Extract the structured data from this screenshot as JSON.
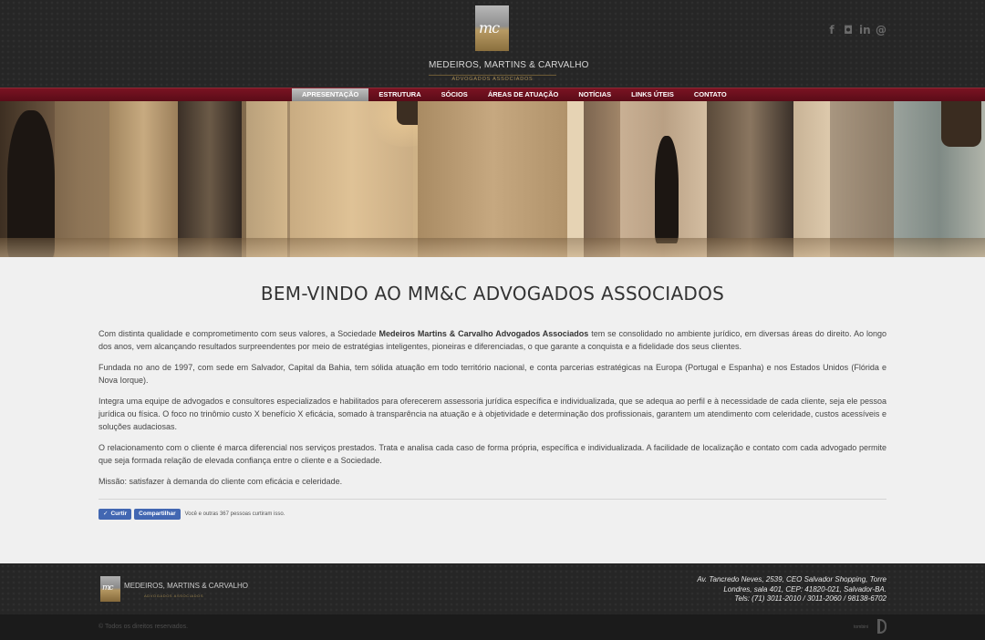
{
  "header": {
    "logo_initials": "mc",
    "logo_name": "MEDEIROS, MARTINS & CARVALHO",
    "logo_subtitle": "ADVOGADOS ASSOCIADOS",
    "social": [
      {
        "icon": "facebook-icon",
        "glyph": "f"
      },
      {
        "icon": "instagram-icon",
        "glyph": "◘"
      },
      {
        "icon": "linkedin-icon",
        "glyph": "in"
      },
      {
        "icon": "email-icon",
        "glyph": "@"
      }
    ]
  },
  "nav": {
    "items": [
      "APRESENTAÇÃO",
      "ESTRUTURA",
      "SÓCIOS",
      "ÁREAS DE ATUAÇÃO",
      "NOTÍCIAS",
      "LINKS ÚTEIS",
      "CONTATO"
    ],
    "active_index": 0
  },
  "main": {
    "title": "BEM-VINDO AO MM&C ADVOGADOS ASSOCIADOS",
    "p1_before": "Com distinta qualidade e comprometimento com seus valores, a Sociedade ",
    "p1_bold": "Medeiros Martins & Carvalho Advogados Associados",
    "p1_after": " tem se consolidado no ambiente jurídico, em diversas áreas do direito. Ao longo dos anos, vem alcançando resultados surpreendentes por meio de estratégias inteligentes, pioneiras e diferenciadas, o que garante a conquista e a fidelidade dos seus clientes.",
    "p2": "Fundada no ano de 1997, com sede em Salvador, Capital da Bahia, tem sólida atuação em todo território nacional, e conta parcerias estratégicas na Europa (Portugal e Espanha) e nos Estados Unidos (Flórida e Nova Iorque).",
    "p3": "Integra uma equipe de advogados e consultores especializados e habilitados para oferecerem assessoria jurídica específica e individualizada, que se adequa ao perfil e à necessidade de cada cliente, seja ele pessoa jurídica ou física. O foco no trinômio custo X benefício X eficácia, somado à transparência na atuação e à objetividade e determinação dos profissionais, garantem um atendimento com celeridade, custos acessíveis e soluções audaciosas.",
    "p4": "O relacionamento com o cliente é marca diferencial nos serviços prestados. Trata e analisa cada caso de forma própria, específica e individualizada. A facilidade de localização e contato com cada advogado permite que seja formada relação de elevada confiança entre o cliente e a Sociedade.",
    "p5": "Missão: satisfazer à demanda do cliente com eficácia e celeridade."
  },
  "facebook": {
    "like_label": "Curtir",
    "share_label": "Compartilhar",
    "like_text": "Você e outras 367 pessoas curtiram isso."
  },
  "footer": {
    "logo_initials": "mc",
    "logo_name": "MEDEIROS, MARTINS & CARVALHO",
    "logo_subtitle": "ADVOGADOS ASSOCIADOS",
    "address_line1": "Av. Tancredo Neves, 2539, CEO Salvador Shopping, Torre",
    "address_line2": "Londres, sala 401, CEP: 41820-021, Salvador-BA.",
    "address_line3": "Tels: (71) 3011-2010 / 3011-2060 / 98138-6702",
    "copyright": "© Todos os direitos reservados.",
    "credit": "tombini"
  },
  "colors": {
    "nav_bg": "#6a0f1d",
    "header_bg": "#262626",
    "gold": "#a88d56",
    "fb_blue": "#4267b2"
  }
}
